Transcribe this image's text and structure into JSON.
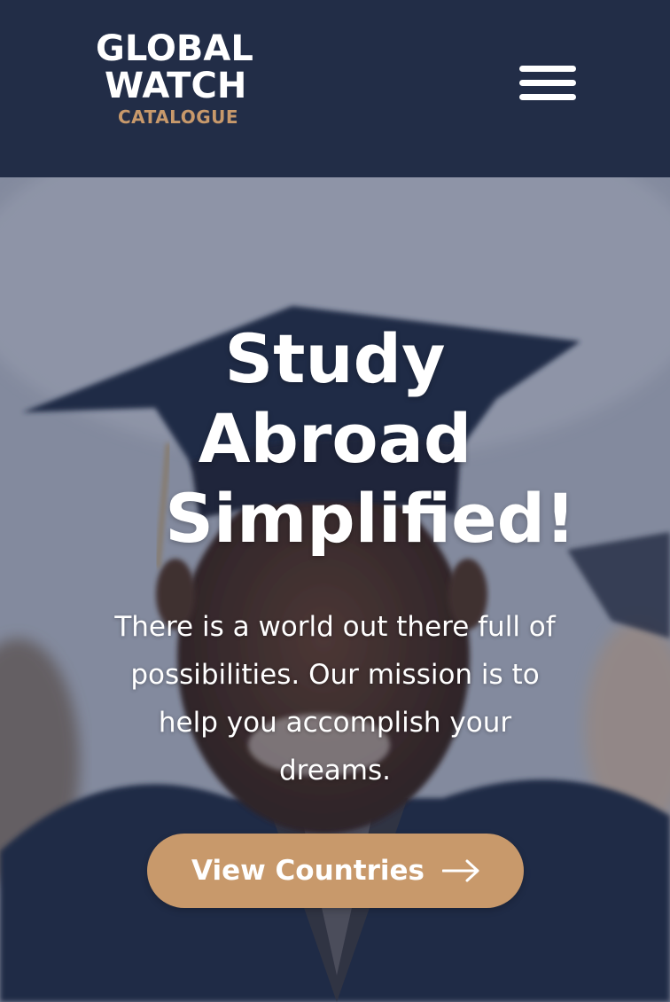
{
  "header": {
    "logo": {
      "line1": "GLOBAL",
      "line2": "WATCH",
      "sub": "CATALOGUE"
    },
    "menu_icon": "hamburger-menu-icon"
  },
  "hero": {
    "title": [
      "Study",
      "Abroad",
      "Simplified!"
    ],
    "description": "There is a world out there full of possibilities. Our mission is to help you accomplish your dreams.",
    "cta": {
      "label": "View Countries",
      "icon": "arrow-right-icon"
    },
    "background_image": "graduate-in-cap-and-gown-photo"
  },
  "colors": {
    "header_bg": "#222d47",
    "accent": "#c8996b",
    "text": "#ffffff"
  }
}
